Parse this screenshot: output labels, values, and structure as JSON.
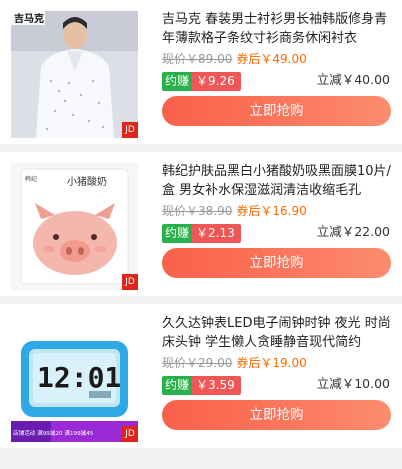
{
  "products": [
    {
      "title": "吉马克 春装男士衬衫男长袖韩版修身青年薄款格子条纹寸衫商务休闲衬衣",
      "image_brand_text": "吉马克",
      "original_price": "现价￥89.00",
      "coupon_price": "券后￥49.00",
      "earn_label": "约赚",
      "earn_amount": "￥9.26",
      "discount": "立减￥40.00",
      "buy_label": "立即抢购",
      "platform_badge": "JD"
    },
    {
      "title": "韩纪护肤品黑白小猪酸奶吸黑面膜10片/盒 男女补水保湿滋润清洁收缩毛孔",
      "image_brand_text": "韩纪",
      "image_product_text": "小猪酸奶",
      "original_price": "现价￥38.90",
      "coupon_price": "券后￥16.90",
      "earn_label": "约赚",
      "earn_amount": "￥2.13",
      "discount": "立减￥22.00",
      "buy_label": "立即抢购",
      "platform_badge": "JD"
    },
    {
      "title": "久久达钟表LED电子闹钟时钟 夜光 时尚床头钟 学生懒人贪睡静音现代简约",
      "image_clock_text": "12:01",
      "image_promo_text": "店铺活动 满99减20 满199减45",
      "original_price": "现价￥29.00",
      "coupon_price": "券后￥19.00",
      "earn_label": "约赚",
      "earn_amount": "￥3.59",
      "discount": "立减￥10.00",
      "buy_label": "立即抢购",
      "platform_badge": "JD"
    }
  ],
  "colors": {
    "coupon": "#ff6a00",
    "earn_tag": "#28b04b",
    "earn_amount": "#ef5656",
    "button": "#f9604a",
    "jd_badge": "#e1251b"
  }
}
